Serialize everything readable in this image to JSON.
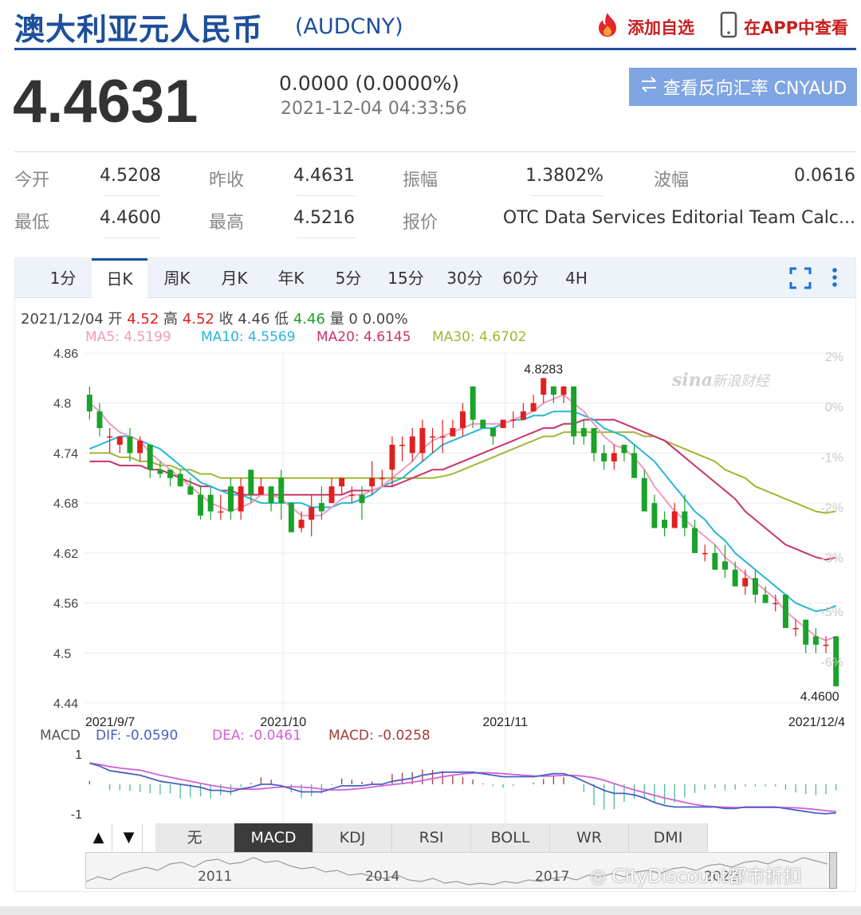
{
  "header": {
    "title": "澳大利亚元人民币",
    "code": "(AUDCNY)",
    "add_fav": "添加自选",
    "open_app": "在APP中查看"
  },
  "quote": {
    "price": "4.4631",
    "change": "0.0000 (0.0000%)",
    "time": "2021-12-04 04:33:56",
    "reverse_btn": "查看反向汇率 CNYAUD"
  },
  "stats": [
    {
      "label": "今开",
      "value": "4.5208"
    },
    {
      "label": "昨收",
      "value": "4.4631"
    },
    {
      "label": "振幅",
      "value": "1.3802%"
    },
    {
      "label": "波幅",
      "value": "0.0616"
    },
    {
      "label": "最低",
      "value": "4.4600"
    },
    {
      "label": "最高",
      "value": "4.5216"
    },
    {
      "label": "报价",
      "value": "OTC Data Services Editorial Team Calc..."
    }
  ],
  "tabs": [
    "1分",
    "日K",
    "周K",
    "月K",
    "年K",
    "5分",
    "15分",
    "30分",
    "60分",
    "4H"
  ],
  "active_tab": "日K",
  "legend": {
    "date": "2021/12/04",
    "open_l": "开",
    "open": "4.52",
    "high_l": "高",
    "high": "4.52",
    "close_l": "收",
    "close": "4.46",
    "low_l": "低",
    "low": "4.46",
    "vol_l": "量",
    "vol": "0",
    "pct": "0.00%"
  },
  "ma_legend": {
    "ma5": "MA5: 4.5199",
    "ma10": "MA10: 4.5569",
    "ma20": "MA20: 4.6145",
    "ma30": "MA30: 4.6702"
  },
  "macd_legend": {
    "name": "MACD",
    "dif": "DIF: -0.0590",
    "dea": "DEA: -0.0461",
    "macd": "MACD: -0.0258"
  },
  "indicators": [
    "无",
    "MACD",
    "KDJ",
    "RSI",
    "BOLL",
    "WR",
    "DMI"
  ],
  "active_indicator": "MACD",
  "navigator_years": [
    "2011",
    "2014",
    "2017",
    "2020"
  ],
  "watermark": "CityDiscount都市折扣",
  "colors": {
    "brand": "#1d4f9a",
    "up": "#e02020",
    "down": "#1aa22a",
    "ma5": "#f09ac0",
    "ma10": "#27b7d6",
    "ma20": "#c8336f",
    "ma30": "#a4b532",
    "dif": "#4a5fc4",
    "dea": "#d45fd6",
    "macd": "#a53a3a",
    "accent_btn": "#7fa6e2"
  },
  "chart_data": {
    "type": "candlestick",
    "y_ticks": [
      "4.86",
      "4.8",
      "4.74",
      "4.68",
      "4.62",
      "4.56",
      "4.5",
      "4.44"
    ],
    "ylim": [
      4.44,
      4.86
    ],
    "pct_ticks": [
      "2%",
      "0%",
      "-1%",
      "-2%",
      "-3%",
      "-5%",
      "-6%"
    ],
    "x_labels": [
      "2021/9/7",
      "2021/10",
      "2021/11",
      "2021/12/4"
    ],
    "max_label": "4.8283",
    "min_label": "4.4600",
    "candles": [
      [
        4.81,
        4.79,
        4.82,
        4.78
      ],
      [
        4.79,
        4.77,
        4.8,
        4.76
      ],
      [
        4.76,
        4.76,
        4.77,
        4.74
      ],
      [
        4.75,
        4.76,
        4.76,
        4.74
      ],
      [
        4.76,
        4.74,
        4.77,
        4.73
      ],
      [
        4.74,
        4.755,
        4.76,
        4.73
      ],
      [
        4.75,
        4.72,
        4.75,
        4.71
      ],
      [
        4.72,
        4.715,
        4.73,
        4.71
      ],
      [
        4.72,
        4.71,
        4.72,
        4.7
      ],
      [
        4.715,
        4.7,
        4.72,
        4.7
      ],
      [
        4.7,
        4.69,
        4.71,
        4.69
      ],
      [
        4.69,
        4.665,
        4.7,
        4.66
      ],
      [
        4.69,
        4.67,
        4.7,
        4.66
      ],
      [
        4.67,
        4.67,
        4.69,
        4.66
      ],
      [
        4.7,
        4.67,
        4.71,
        4.66
      ],
      [
        4.67,
        4.7,
        4.71,
        4.66
      ],
      [
        4.72,
        4.69,
        4.72,
        4.68
      ],
      [
        4.69,
        4.7,
        4.71,
        4.69
      ],
      [
        4.7,
        4.68,
        4.7,
        4.67
      ],
      [
        4.71,
        4.68,
        4.72,
        4.66
      ],
      [
        4.68,
        4.645,
        4.68,
        4.645
      ],
      [
        4.65,
        4.66,
        4.67,
        4.645
      ],
      [
        4.66,
        4.675,
        4.69,
        4.64
      ],
      [
        4.68,
        4.67,
        4.7,
        4.66
      ],
      [
        4.68,
        4.7,
        4.71,
        4.68
      ],
      [
        4.7,
        4.71,
        4.71,
        4.69
      ],
      [
        4.69,
        4.69,
        4.7,
        4.68
      ],
      [
        4.69,
        4.68,
        4.7,
        4.66
      ],
      [
        4.7,
        4.71,
        4.73,
        4.69
      ],
      [
        4.71,
        4.71,
        4.72,
        4.7
      ],
      [
        4.72,
        4.75,
        4.76,
        4.7
      ],
      [
        4.75,
        4.75,
        4.76,
        4.73
      ],
      [
        4.74,
        4.76,
        4.77,
        4.73
      ],
      [
        4.74,
        4.77,
        4.78,
        4.73
      ],
      [
        4.76,
        4.76,
        4.77,
        4.74
      ],
      [
        4.76,
        4.76,
        4.78,
        4.74
      ],
      [
        4.76,
        4.77,
        4.78,
        4.76
      ],
      [
        4.77,
        4.79,
        4.8,
        4.76
      ],
      [
        4.82,
        4.78,
        4.82,
        4.77
      ],
      [
        4.78,
        4.77,
        4.78,
        4.77
      ],
      [
        4.77,
        4.76,
        4.77,
        4.75
      ],
      [
        4.77,
        4.78,
        4.78,
        4.77
      ],
      [
        4.78,
        4.78,
        4.79,
        4.77
      ],
      [
        4.78,
        4.79,
        4.8,
        4.78
      ],
      [
        4.79,
        4.8,
        4.81,
        4.79
      ],
      [
        4.81,
        4.83,
        4.83,
        4.8
      ],
      [
        4.82,
        4.81,
        4.82,
        4.8
      ],
      [
        4.81,
        4.82,
        4.82,
        4.8
      ],
      [
        4.82,
        4.76,
        4.82,
        4.75
      ],
      [
        4.77,
        4.76,
        4.78,
        4.75
      ],
      [
        4.77,
        4.74,
        4.77,
        4.73
      ],
      [
        4.74,
        4.73,
        4.75,
        4.72
      ],
      [
        4.73,
        4.74,
        4.75,
        4.72
      ],
      [
        4.75,
        4.74,
        4.75,
        4.73
      ],
      [
        4.74,
        4.71,
        4.75,
        4.71
      ],
      [
        4.71,
        4.67,
        4.72,
        4.67
      ],
      [
        4.68,
        4.65,
        4.69,
        4.65
      ],
      [
        4.66,
        4.65,
        4.67,
        4.64
      ],
      [
        4.65,
        4.67,
        4.68,
        4.65
      ],
      [
        4.67,
        4.65,
        4.69,
        4.64
      ],
      [
        4.65,
        4.62,
        4.66,
        4.62
      ],
      [
        4.62,
        4.62,
        4.63,
        4.61
      ],
      [
        4.62,
        4.6,
        4.63,
        4.6
      ],
      [
        4.61,
        4.6,
        4.63,
        4.59
      ],
      [
        4.6,
        4.58,
        4.61,
        4.58
      ],
      [
        4.58,
        4.59,
        4.6,
        4.57
      ],
      [
        4.59,
        4.57,
        4.6,
        4.56
      ],
      [
        4.57,
        4.56,
        4.58,
        4.56
      ],
      [
        4.56,
        4.56,
        4.57,
        4.55
      ],
      [
        4.57,
        4.53,
        4.57,
        4.53
      ],
      [
        4.53,
        4.53,
        4.54,
        4.52
      ],
      [
        4.54,
        4.51,
        4.54,
        4.5
      ],
      [
        4.52,
        4.51,
        4.53,
        4.5
      ],
      [
        4.51,
        4.51,
        4.52,
        4.5
      ],
      [
        4.52,
        4.46,
        4.52,
        4.46
      ]
    ],
    "ma5": [
      4.8,
      4.79,
      4.775,
      4.765,
      4.76,
      4.755,
      4.74,
      4.73,
      4.72,
      4.71,
      4.7,
      4.69,
      4.68,
      4.675,
      4.67,
      4.675,
      4.68,
      4.69,
      4.69,
      4.685,
      4.675,
      4.665,
      4.665,
      4.665,
      4.675,
      4.685,
      4.69,
      4.69,
      4.695,
      4.7,
      4.71,
      4.72,
      4.73,
      4.745,
      4.755,
      4.76,
      4.765,
      4.77,
      4.775,
      4.775,
      4.775,
      4.775,
      4.78,
      4.785,
      4.79,
      4.8,
      4.805,
      4.81,
      4.8,
      4.79,
      4.775,
      4.76,
      4.75,
      4.745,
      4.735,
      4.72,
      4.7,
      4.685,
      4.67,
      4.66,
      4.65,
      4.64,
      4.63,
      4.615,
      4.605,
      4.595,
      4.585,
      4.575,
      4.565,
      4.55,
      4.54,
      4.53,
      4.52,
      4.515,
      4.5199
    ],
    "ma10": [
      4.745,
      4.75,
      4.755,
      4.76,
      4.76,
      4.755,
      4.75,
      4.745,
      4.735,
      4.725,
      4.715,
      4.705,
      4.7,
      4.695,
      4.69,
      4.69,
      4.685,
      4.68,
      4.68,
      4.68,
      4.68,
      4.68,
      4.675,
      4.675,
      4.675,
      4.68,
      4.68,
      4.685,
      4.69,
      4.7,
      4.705,
      4.71,
      4.72,
      4.73,
      4.74,
      4.75,
      4.755,
      4.76,
      4.765,
      4.77,
      4.77,
      4.775,
      4.78,
      4.78,
      4.785,
      4.785,
      4.79,
      4.79,
      4.79,
      4.785,
      4.78,
      4.77,
      4.765,
      4.76,
      4.75,
      4.74,
      4.73,
      4.715,
      4.7,
      4.685,
      4.67,
      4.66,
      4.645,
      4.635,
      4.62,
      4.61,
      4.6,
      4.59,
      4.58,
      4.57,
      4.56,
      4.555,
      4.55,
      4.552,
      4.5569
    ],
    "ma20": [
      4.73,
      4.73,
      4.73,
      4.725,
      4.725,
      4.725,
      4.72,
      4.72,
      4.715,
      4.71,
      4.705,
      4.7,
      4.7,
      4.695,
      4.695,
      4.69,
      4.69,
      4.69,
      4.69,
      4.69,
      4.69,
      4.69,
      4.69,
      4.69,
      4.69,
      4.69,
      4.695,
      4.695,
      4.695,
      4.7,
      4.7,
      4.705,
      4.71,
      4.715,
      4.72,
      4.72,
      4.725,
      4.73,
      4.735,
      4.74,
      4.745,
      4.75,
      4.755,
      4.76,
      4.765,
      4.77,
      4.77,
      4.775,
      4.775,
      4.78,
      4.78,
      4.78,
      4.78,
      4.775,
      4.77,
      4.765,
      4.76,
      4.755,
      4.745,
      4.735,
      4.725,
      4.715,
      4.705,
      4.695,
      4.685,
      4.67,
      4.66,
      4.65,
      4.64,
      4.63,
      4.625,
      4.62,
      4.615,
      4.612,
      4.6145
    ],
    "ma30": [
      4.74,
      4.74,
      4.74,
      4.735,
      4.735,
      4.73,
      4.73,
      4.725,
      4.725,
      4.72,
      4.72,
      4.715,
      4.715,
      4.71,
      4.71,
      4.71,
      4.71,
      4.71,
      4.71,
      4.71,
      4.71,
      4.71,
      4.71,
      4.71,
      4.71,
      4.71,
      4.71,
      4.71,
      4.71,
      4.71,
      4.71,
      4.71,
      4.71,
      4.71,
      4.71,
      4.712,
      4.715,
      4.72,
      4.725,
      4.73,
      4.735,
      4.74,
      4.745,
      4.75,
      4.755,
      4.76,
      4.76,
      4.765,
      4.765,
      4.765,
      4.765,
      4.765,
      4.765,
      4.765,
      4.765,
      4.76,
      4.76,
      4.755,
      4.75,
      4.745,
      4.74,
      4.735,
      4.73,
      4.72,
      4.715,
      4.71,
      4.7,
      4.695,
      4.69,
      4.685,
      4.68,
      4.675,
      4.67,
      4.668,
      4.6702
    ]
  }
}
